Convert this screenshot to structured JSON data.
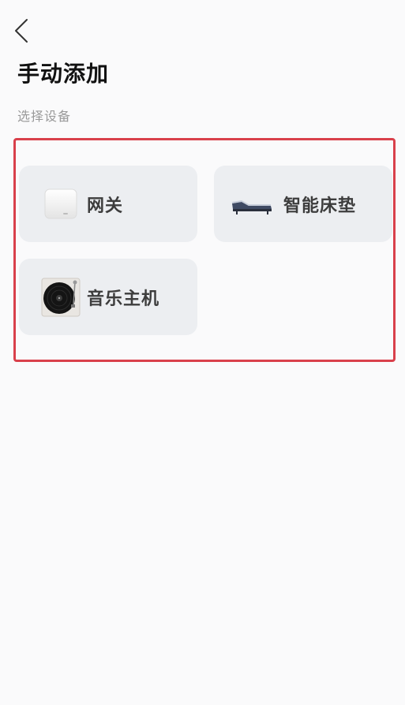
{
  "header": {
    "back_icon": "chevron-left-icon",
    "title": "手动添加"
  },
  "section": {
    "label": "选择设备"
  },
  "colors": {
    "frame_border": "#d9404b",
    "card_bg": "#eceef1",
    "page_bg": "#fafafb"
  },
  "devices": [
    {
      "label": "网关",
      "icon": "gateway-device-icon"
    },
    {
      "label": "智能床垫",
      "icon": "smart-mattress-icon"
    },
    {
      "label": "音乐主机",
      "icon": "turntable-icon"
    }
  ]
}
